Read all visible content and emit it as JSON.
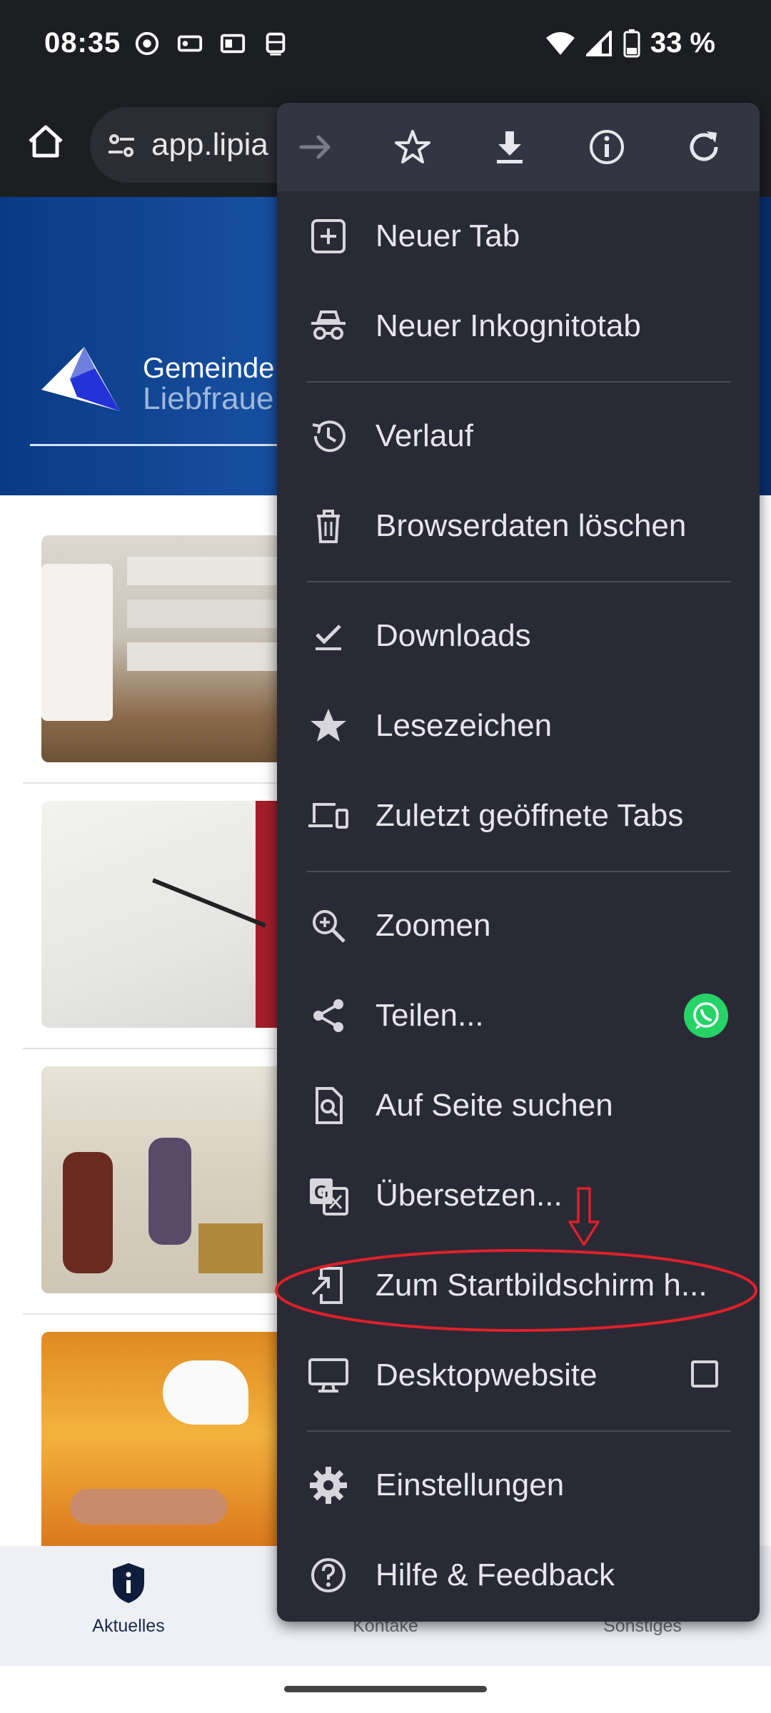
{
  "status_bar": {
    "time": "08:35",
    "notification_icons": [
      "chrome-icon",
      "car-icon",
      "outlook-icon",
      "tram-icon"
    ],
    "battery": "33 %"
  },
  "toolbar": {
    "url": "app.lipia"
  },
  "page": {
    "logo_line1": "Gemeinde",
    "logo_line2": "Liebfraue"
  },
  "menu": {
    "header_icons": [
      "forward-icon",
      "star-icon",
      "download-icon",
      "info-icon",
      "reload-icon"
    ],
    "items": [
      {
        "label": "Neuer Tab",
        "icon": "new-tab-icon"
      },
      {
        "label": "Neuer Inkognitotab",
        "icon": "incognito-icon"
      },
      {
        "label": "Verlauf",
        "icon": "history-icon"
      },
      {
        "label": "Browserdaten löschen",
        "icon": "trash-icon"
      },
      {
        "label": "Downloads",
        "icon": "downloads-icon"
      },
      {
        "label": "Lesezeichen",
        "icon": "bookmark-star-icon"
      },
      {
        "label": "Zuletzt geöffnete Tabs",
        "icon": "devices-icon"
      },
      {
        "label": "Zoomen",
        "icon": "zoom-icon"
      },
      {
        "label": "Teilen...",
        "icon": "share-icon"
      },
      {
        "label": "Auf Seite suchen",
        "icon": "find-in-page-icon"
      },
      {
        "label": "Übersetzen...",
        "icon": "translate-icon"
      },
      {
        "label": "Zum Startbildschirm h...",
        "icon": "add-to-home-icon"
      },
      {
        "label": "Desktopwebsite",
        "icon": "desktop-icon"
      },
      {
        "label": "Einstellungen",
        "icon": "settings-icon"
      },
      {
        "label": "Hilfe & Feedback",
        "icon": "help-icon"
      }
    ],
    "desktop_site_checked": false
  },
  "bottom_nav": {
    "items": [
      {
        "label": "Aktuelles",
        "icon": "shield-info-icon",
        "active": true
      },
      {
        "label": "Kontake",
        "icon": "contacts-icon",
        "active": false
      },
      {
        "label": "Sonstiges",
        "icon": "more-icon",
        "active": false
      }
    ]
  },
  "colors": {
    "menu_bg": "#292a35",
    "menu_header_bg": "#343543",
    "annotation_red": "#e0202a",
    "whatsapp_green": "#25d366"
  }
}
